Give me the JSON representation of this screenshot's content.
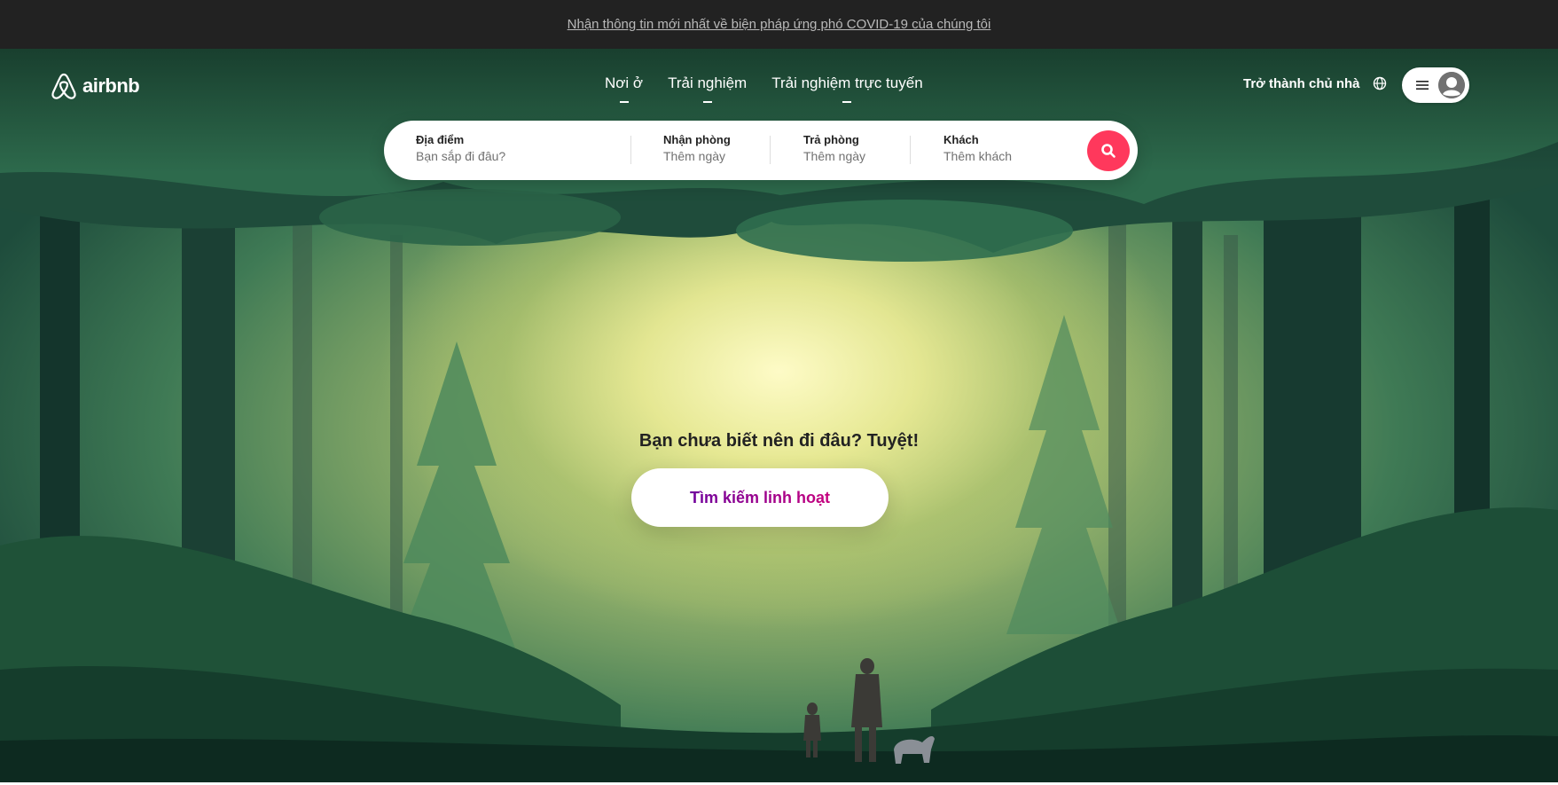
{
  "banner": {
    "text": "Nhận thông tin mới nhất về biện pháp ứng phó COVID-19 của chúng tôi"
  },
  "brand": {
    "name": "airbnb",
    "logo_icon": "airbnb-belo-icon"
  },
  "nav": {
    "tabs": [
      {
        "label": "Nơi ở"
      },
      {
        "label": "Trải nghiệm"
      },
      {
        "label": "Trải nghiệm trực tuyến"
      }
    ]
  },
  "header": {
    "host_link": "Trở thành chủ nhà",
    "globe_icon": "globe-icon",
    "menu_icon": "hamburger-icon",
    "avatar_icon": "user-avatar-icon"
  },
  "search": {
    "location": {
      "label": "Địa điểm",
      "placeholder": "Bạn sắp đi đâu?"
    },
    "checkin": {
      "label": "Nhận phòng",
      "placeholder": "Thêm ngày"
    },
    "checkout": {
      "label": "Trả phòng",
      "placeholder": "Thêm ngày"
    },
    "guests": {
      "label": "Khách",
      "placeholder": "Thêm khách"
    },
    "button_icon": "search-icon"
  },
  "hero": {
    "prompt": "Bạn chưa biết nên đi đâu? Tuyệt!",
    "cta_label": "Tìm kiếm linh hoạt",
    "image": "forest-illustration"
  },
  "colors": {
    "brand_red": "#ff385c",
    "cta_gradient_start": "#6f019c",
    "cta_gradient_end": "#c6017e",
    "banner_bg": "#222222"
  }
}
